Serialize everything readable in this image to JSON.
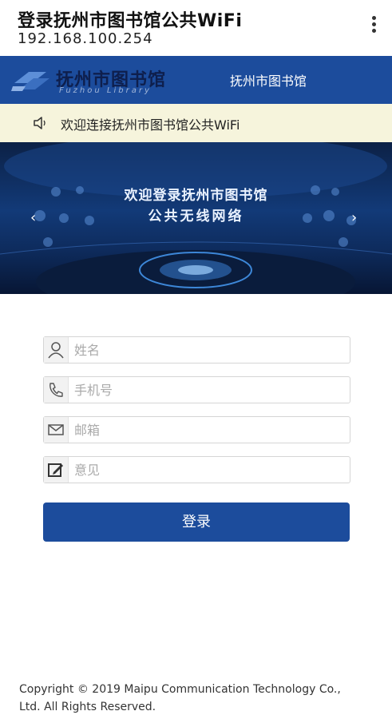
{
  "browser": {
    "title": "登录抚州市图书馆公共WiFi",
    "url": "192.168.100.254"
  },
  "header": {
    "logo_cn": "抚州市图书馆",
    "logo_en": "Fuzhou Library",
    "title": "抚州市图书馆"
  },
  "notice": {
    "text": "欢迎连接抚州市图书馆公共WiFi"
  },
  "banner": {
    "line1": "欢迎登录抚州市图书馆",
    "line2": "公共无线网络",
    "prev": "‹",
    "next": "›"
  },
  "form": {
    "name_placeholder": "姓名",
    "phone_placeholder": "手机号",
    "email_placeholder": "邮箱",
    "feedback_placeholder": "意见",
    "submit_label": "登录"
  },
  "footer": {
    "line1": "Copyright © 2019 Maipu Communication Technology Co.,",
    "line2": "Ltd. All Rights Reserved."
  },
  "colors": {
    "primary": "#1c4c9c",
    "notice_bg": "#f6f4dc",
    "banner_bg": "#0c2146"
  },
  "icons": [
    "menu-icon",
    "library-logo-icon",
    "speaker-icon",
    "user-icon",
    "phone-icon",
    "mail-icon",
    "edit-icon"
  ]
}
